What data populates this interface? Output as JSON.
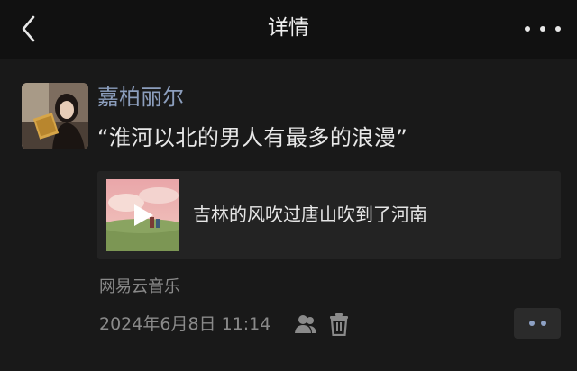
{
  "header": {
    "title": "详情",
    "back_icon": "chevron-left-icon",
    "more_icon": "more-horizontal-icon"
  },
  "post": {
    "username": "嘉柏丽尔",
    "text": "“淮河以北的男人有最多的浪漫”",
    "music": {
      "title": "吉林的风吹过唐山吹到了河南",
      "cover_icon": "play-icon"
    },
    "source": "网易云音乐",
    "timestamp": "2024年6月8日 11:14",
    "visibility_icon": "friends-visibility-icon",
    "delete_icon": "trash-icon",
    "comment_icon": "comment-more-icon"
  },
  "colors": {
    "background": "#191919",
    "header_background": "#111111",
    "username": "#8c9ebd",
    "secondary_text": "#8a8a8a",
    "card_background": "#232323"
  }
}
